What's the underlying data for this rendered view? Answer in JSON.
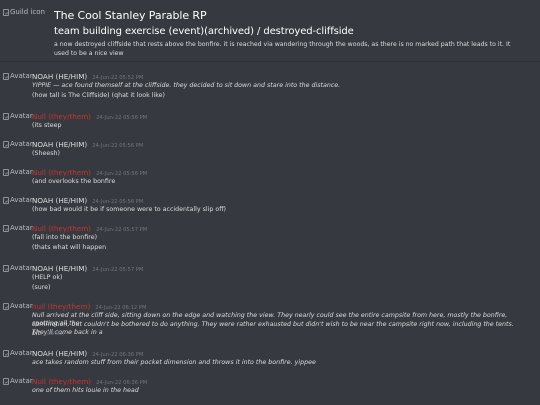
{
  "header": {
    "guild_icon_alt": "Guild icon",
    "guild_name": "The Cool Stanley Parable RP",
    "channel_path": "team building exercise (event)(archived) / destroyed-cliffside",
    "topic": "a now destroyed cliffside that rests above the bonfire. it is reached via wandering through the woods, as there is no marked path that leads to it. It used to be a nice view"
  },
  "avatar_alt": "Avatar",
  "edited_label": "(edited)",
  "messages": [
    {
      "author": "NOAH (HE/HIM)",
      "timestamp": "24-Jun-22 05:52 PM",
      "lines": [
        "YIPPIE — ace found themself at the cliffside. they decided to sit down and stare into the distance.",
        "(how tall is The Cliffside) (qhat it look like)"
      ]
    },
    {
      "author": "Null (they/them)",
      "timestamp": "24-Jun-22 05:56 PM",
      "lines": [
        "(its steep"
      ]
    },
    {
      "author": "NOAH (HE/HIM)",
      "timestamp": "24-Jun-22 05:56 PM",
      "lines": [
        "(Sheesh)"
      ]
    },
    {
      "author": "Null (they/them)",
      "timestamp": "24-Jun-22 05:56 PM",
      "lines": [
        "(and overlooks the bonfire"
      ]
    },
    {
      "author": "NOAH (HE/HIM)",
      "timestamp": "24-Jun-22 05:56 PM",
      "lines": [
        "(how bad would it be if someone were to accidentally slip off)"
      ]
    },
    {
      "author": "Null (they/them)",
      "timestamp": "24-Jun-22 05:57 PM",
      "lines": [
        "(fall into the bonfire)",
        "(thats what will happen"
      ]
    },
    {
      "author": "NOAH (HE/HIM)",
      "timestamp": "24-Jun-22 05:57 PM",
      "lines": [
        "(HELP ok)",
        "(sure)"
      ]
    },
    {
      "author": "null (they/them)",
      "timestamp": "24-Jun-22 06:12 PM",
      "lines": [
        "Null arrived at the cliff side, sitting down on the edge and watching the view. They nearly could see the entire campsite from here, mostly the bonfire, spotting all the",
        "commotion, but couldn't be bothered to do anything. They were rather exhausted but didn't wish to be near the campsite right now, including the tents. They'll come back in a",
        "bit."
      ]
    },
    {
      "author": "NOAH (HE/HIM)",
      "timestamp": "24-Jun-22 06:36 PM",
      "lines": [
        "ace takes random stuff from their pocket dimension and throws it into the bonfire. yippee"
      ]
    },
    {
      "author": "Null (they/them)",
      "timestamp": "24-Jun-22 06:36 PM",
      "lines": [
        "one of them hits louie in the head"
      ]
    }
  ]
}
